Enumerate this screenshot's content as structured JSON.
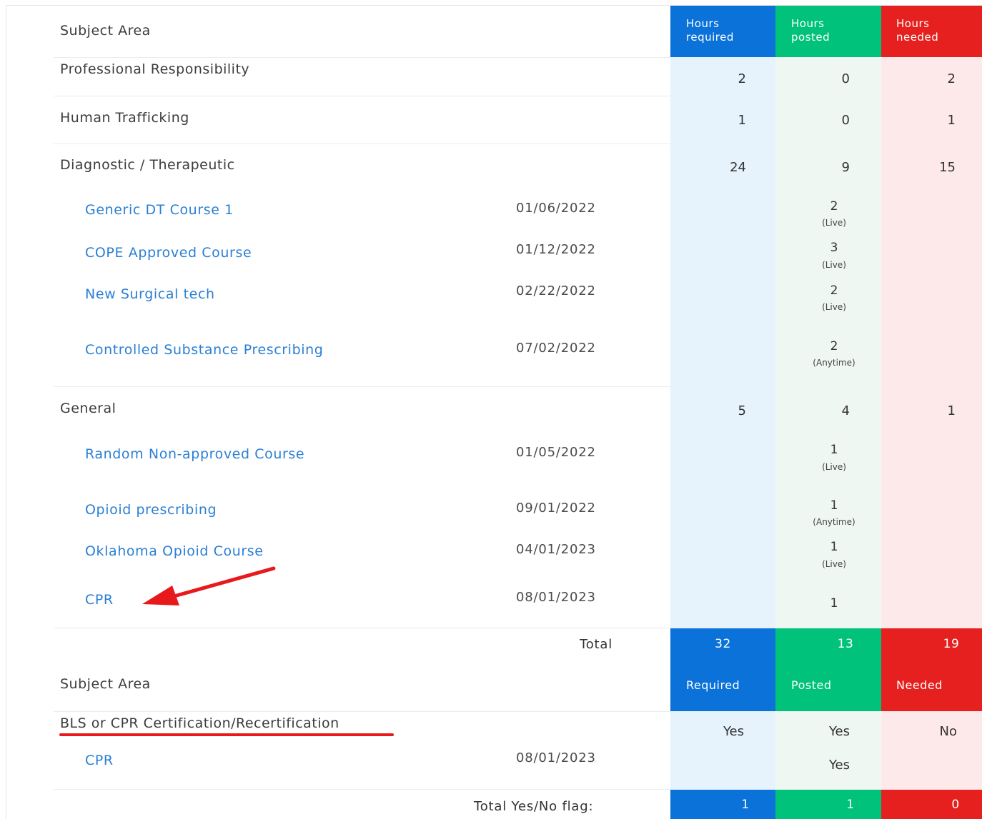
{
  "header": {
    "subject_area": "Subject Area",
    "hours_required": [
      "Hours",
      "required"
    ],
    "hours_posted": [
      "Hours",
      "posted"
    ],
    "hours_needed": [
      "Hours",
      "needed"
    ]
  },
  "rows": {
    "prof": {
      "subject": "Professional Responsibility",
      "req": "2",
      "posted": "0",
      "needed": "2"
    },
    "human": {
      "subject": "Human Trafficking",
      "req": "1",
      "posted": "0",
      "needed": "1"
    },
    "diag": {
      "subject": "Diagnostic / Therapeutic",
      "req": "24",
      "posted": "9",
      "needed": "15"
    },
    "general": {
      "subject": "General",
      "req": "5",
      "posted": "4",
      "needed": "1"
    }
  },
  "courses": [
    {
      "name": "Generic DT Course 1",
      "date": "01/06/2022",
      "hours": "2",
      "type": "(Live)"
    },
    {
      "name": "COPE Approved Course",
      "date": "01/12/2022",
      "hours": "3",
      "type": "(Live)"
    },
    {
      "name": "New Surgical tech",
      "date": "02/22/2022",
      "hours": "2",
      "type": "(Live)"
    },
    {
      "name": "Controlled Substance Prescribing",
      "date": "07/02/2022",
      "hours": "2",
      "type": "(Anytime)"
    },
    {
      "name": "Random Non-approved Course",
      "date": "01/05/2022",
      "hours": "1",
      "type": "(Live)"
    },
    {
      "name": "Opioid prescribing",
      "date": "09/01/2022",
      "hours": "1",
      "type": "(Anytime)"
    },
    {
      "name": "Oklahoma Opioid Course",
      "date": "04/01/2023",
      "hours": "1",
      "type": "(Live)"
    },
    {
      "name": "CPR",
      "date": "08/01/2023",
      "hours": "1",
      "type": ""
    }
  ],
  "total": {
    "label": "Total",
    "req": "32",
    "posted": "13",
    "needed": "19"
  },
  "second_header": {
    "subject_area": "Subject Area",
    "required": "Required",
    "posted": "Posted",
    "needed": "Needed"
  },
  "bls": {
    "subject": "BLS or CPR Certification/Recertification",
    "req": "Yes",
    "posted": "Yes",
    "needed": "No"
  },
  "bls_course": {
    "name": "CPR",
    "date": "08/01/2023",
    "posted": "Yes"
  },
  "flag_total": {
    "label": "Total Yes/No flag:",
    "req": "1",
    "posted": "1",
    "needed": "0"
  },
  "colors": {
    "required": "#0a72d9",
    "posted": "#00c27a",
    "needed": "#e5201f",
    "link": "#2a7fd4",
    "annotation": "#e8191c"
  }
}
